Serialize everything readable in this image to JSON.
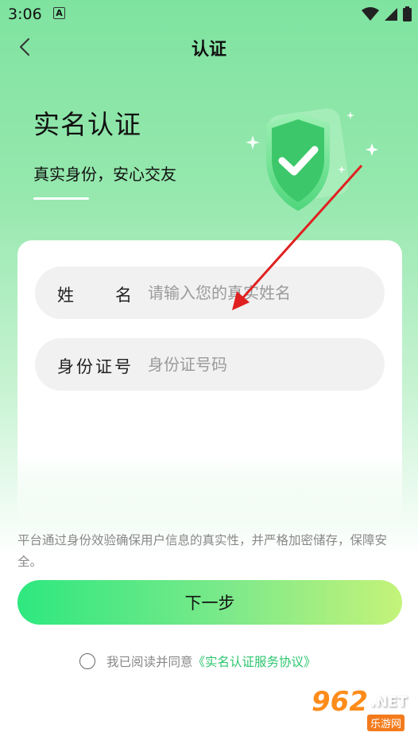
{
  "status": {
    "time": "3:06",
    "notif_letter": "A"
  },
  "nav": {
    "title": "认证"
  },
  "hero": {
    "title": "实名认证",
    "subtitle": "真实身份，安心交友"
  },
  "form": {
    "name_label": "姓名",
    "name_placeholder": "请输入您的真实姓名",
    "id_label": "身份证号",
    "id_placeholder": "身份证号码"
  },
  "notice": "平台通过身份效验确保用户信息的真实性，并严格加密储存，保障安全。",
  "next_label": "下一步",
  "agreement": {
    "text": "我已阅读并同意",
    "link": "《实名认证服务协议》"
  },
  "watermark": {
    "brand": "962",
    "net": ".NET",
    "site": "乐游网"
  },
  "colors": {
    "accent": "#2cc66e",
    "button_start": "#2ee87f",
    "button_end": "#c4f379",
    "arrow": "#e02020"
  }
}
